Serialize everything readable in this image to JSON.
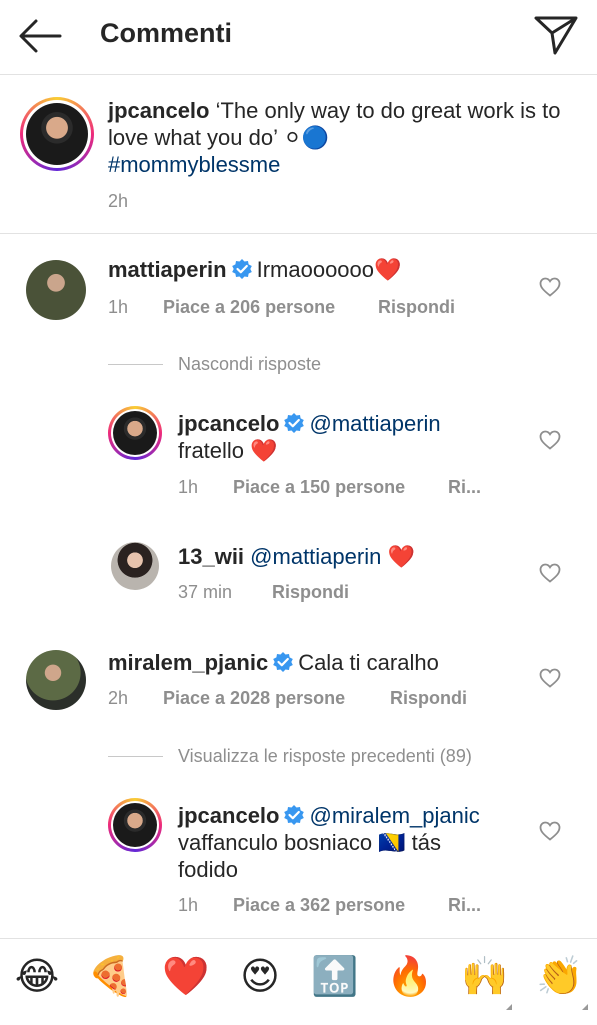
{
  "header": {
    "title": "Commenti"
  },
  "caption": {
    "user": "jpcancelo",
    "text": "‘The only way to do great work is to love what you do’ ⚪🔵",
    "hashtag": "#mommyblessme",
    "time": "2h"
  },
  "comments": [
    {
      "user": "mattiaperin",
      "text": "Irmaoooooo❤️",
      "time": "1h",
      "likes": "Piace a 206 persone",
      "reply": "Rispondi"
    },
    {
      "user": "miralem_pjanic",
      "text": "Cala ti caralho",
      "time": "2h",
      "likes": "Piace a 2028 persone",
      "reply": "Rispondi"
    }
  ],
  "thread1": {
    "toggle": "Nascondi risposte",
    "replies": [
      {
        "user": "jpcancelo",
        "mention": "@mattiaperin",
        "text": "fratello ❤️",
        "time": "1h",
        "likes": "Piace a 150 persone",
        "reply": "Ri..."
      },
      {
        "user": "13_wii",
        "mention": "@mattiaperin",
        "text": "❤️",
        "time": "37 min",
        "reply": "Rispondi"
      }
    ]
  },
  "thread2": {
    "toggle": "Visualizza le risposte precedenti (89)",
    "reply": {
      "user": "jpcancelo",
      "mention": "@miralem_pjanic",
      "text1": "vaffanculo bosniaco 🇧🇦 tás",
      "text2": "fodido",
      "time": "1h",
      "likes": "Piace a 362 persone",
      "reply": "Ri..."
    }
  },
  "emoji_bar": [
    "😂",
    "🍕",
    "❤️",
    "😍",
    "🔝",
    "🔥",
    "🙌",
    "👏"
  ],
  "colors": {
    "verified": "#3897f0",
    "mention": "#003569",
    "meta": "#8e8e8e"
  }
}
